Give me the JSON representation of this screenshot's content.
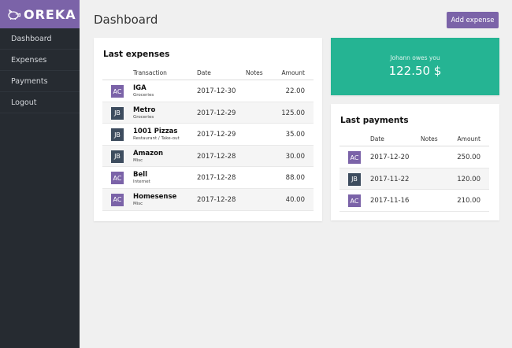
{
  "brand": {
    "name": "OREKA",
    "icon": "piggy-bank-icon",
    "color": "#7b63a8"
  },
  "sidebar": {
    "items": [
      {
        "label": "Dashboard"
      },
      {
        "label": "Expenses"
      },
      {
        "label": "Payments"
      },
      {
        "label": "Logout"
      }
    ]
  },
  "page": {
    "title": "Dashboard",
    "add_button": "Add expense"
  },
  "balance": {
    "label": "Johann owes you",
    "amount": "122.50 $",
    "color": "#25b493"
  },
  "expenses": {
    "title": "Last expenses",
    "headers": {
      "transaction": "Transaction",
      "date": "Date",
      "notes": "Notes",
      "amount": "Amount"
    },
    "rows": [
      {
        "avatar": "AC",
        "name": "IGA",
        "category": "Groceries",
        "date": "2017-12-30",
        "notes": "",
        "amount": "22.00"
      },
      {
        "avatar": "JB",
        "name": "Metro",
        "category": "Groceries",
        "date": "2017-12-29",
        "notes": "",
        "amount": "125.00"
      },
      {
        "avatar": "JB",
        "name": "1001 Pizzas",
        "category": "Restaurant / Take-out",
        "date": "2017-12-29",
        "notes": "",
        "amount": "35.00"
      },
      {
        "avatar": "JB",
        "name": "Amazon",
        "category": "Misc",
        "date": "2017-12-28",
        "notes": "",
        "amount": "30.00"
      },
      {
        "avatar": "AC",
        "name": "Bell",
        "category": "Internet",
        "date": "2017-12-28",
        "notes": "",
        "amount": "88.00"
      },
      {
        "avatar": "AC",
        "name": "Homesense",
        "category": "Misc",
        "date": "2017-12-28",
        "notes": "",
        "amount": "40.00"
      }
    ]
  },
  "payments": {
    "title": "Last payments",
    "headers": {
      "date": "Date",
      "notes": "Notes",
      "amount": "Amount"
    },
    "rows": [
      {
        "avatar": "AC",
        "date": "2017-12-20",
        "notes": "",
        "amount": "250.00"
      },
      {
        "avatar": "JB",
        "date": "2017-11-22",
        "notes": "",
        "amount": "120.00"
      },
      {
        "avatar": "AC",
        "date": "2017-11-16",
        "notes": "",
        "amount": "210.00"
      }
    ]
  }
}
